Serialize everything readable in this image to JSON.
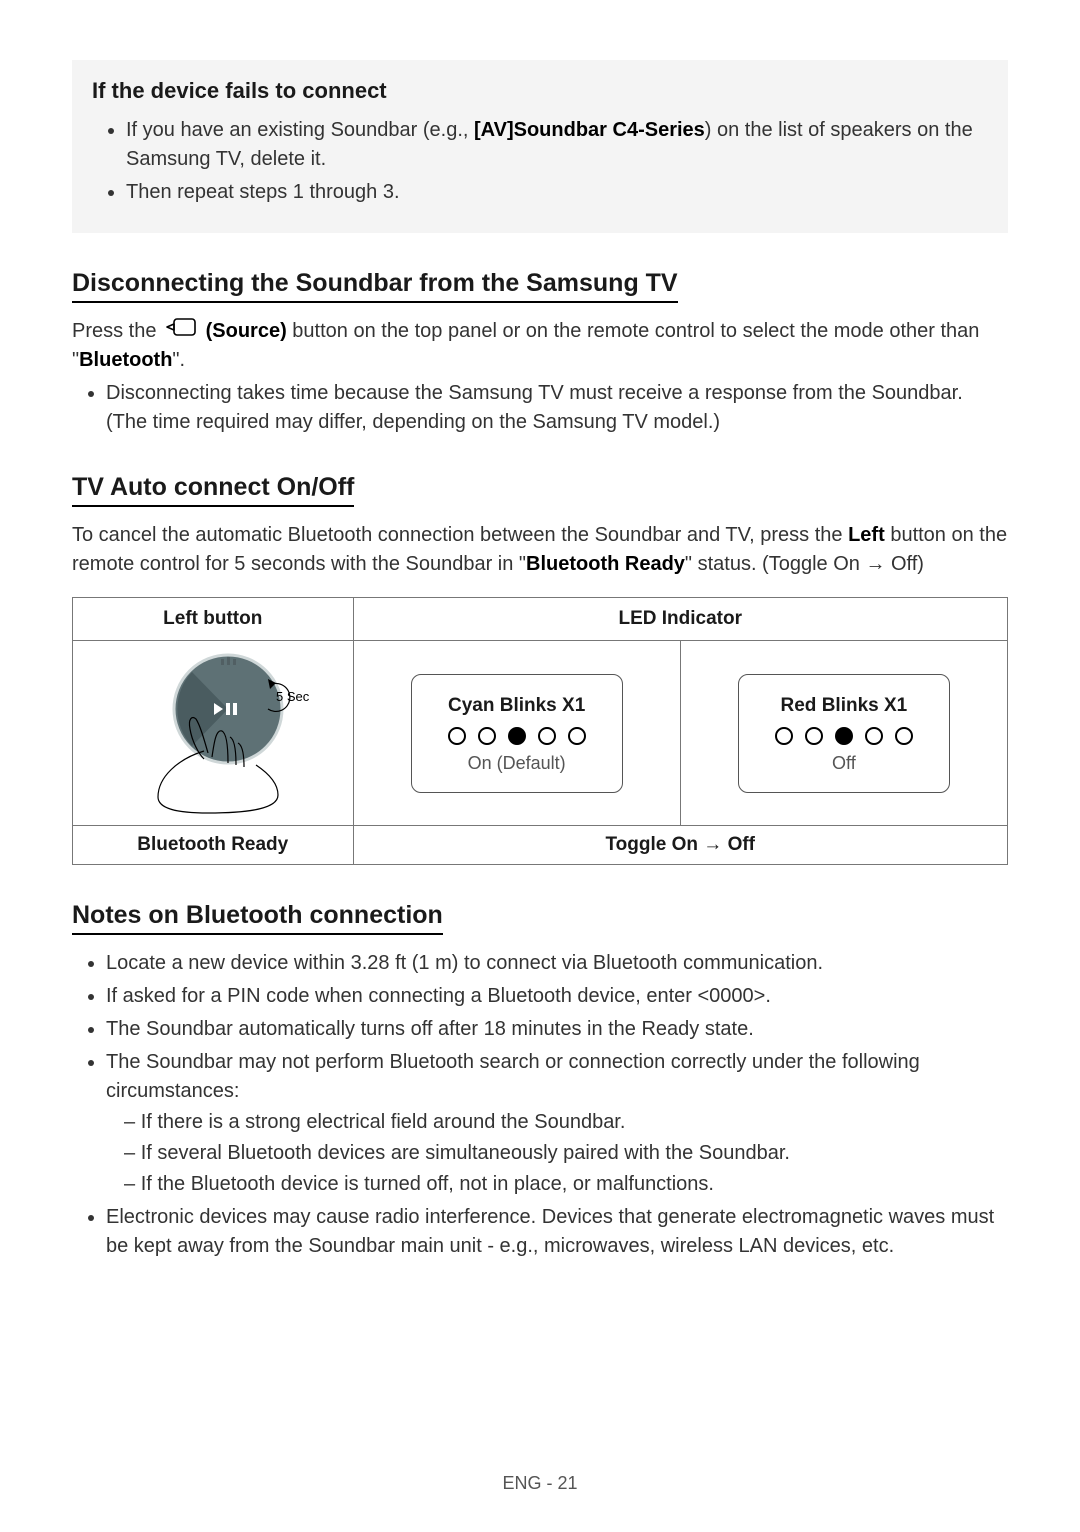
{
  "callout": {
    "heading": "If the device fails to connect",
    "items": [
      {
        "pre": "If you have an existing Soundbar (e.g., ",
        "bold": "[AV]Soundbar C4-Series",
        "post": ") on the list of speakers on the Samsung TV, delete it."
      },
      {
        "pre": "Then repeat steps 1 through 3.",
        "bold": "",
        "post": ""
      }
    ]
  },
  "disc": {
    "heading": "Disconnecting the Soundbar from the Samsung TV",
    "p1_pre": "Press the ",
    "p1_bold": "(Source)",
    "p1_mid": " button on the top panel or on the remote control to select the mode other than \"",
    "p1_bold2": "Bluetooth",
    "p1_post": "\".",
    "bullet": "Disconnecting takes time because the Samsung TV must receive a response from the Soundbar. (The time required may differ, depending on the Samsung TV model.)"
  },
  "auto": {
    "heading": "TV Auto connect On/Off",
    "p_pre": "To cancel the automatic Bluetooth connection between the Soundbar and TV, press the ",
    "p_bold1": "Left",
    "p_mid": " button on the remote control for 5 seconds with the Soundbar in \"",
    "p_bold2": "Bluetooth Ready",
    "p_post": "\" status. (Toggle On → Off)"
  },
  "table": {
    "h_left": "Left button",
    "h_led": "LED Indicator",
    "remote_label": "5 Sec",
    "cyan_title": "Cyan Blinks X1",
    "cyan_sub": "On (Default)",
    "red_title": "Red Blinks X1",
    "red_sub": "Off",
    "row2_left": "Bluetooth Ready",
    "row2_right": "Toggle On → Off"
  },
  "notes": {
    "heading": "Notes on Bluetooth connection",
    "items": [
      "Locate a new device within 3.28 ft (1 m) to connect via Bluetooth communication.",
      "If asked for a PIN code when connecting a Bluetooth device, enter <0000>.",
      "The Soundbar automatically turns off after 18 minutes in the Ready state.",
      "The Soundbar may not perform Bluetooth search or connection correctly under the following circumstances:",
      "Electronic devices may cause radio interference. Devices that generate electromagnetic waves must be kept away from the Soundbar main unit - e.g., microwaves, wireless LAN devices, etc."
    ],
    "sub": [
      "If there is a strong electrical field around the Soundbar.",
      "If several Bluetooth devices are simultaneously paired with the Soundbar.",
      "If the Bluetooth device is turned off, not in place, or malfunctions."
    ]
  },
  "footer": "ENG - 21"
}
